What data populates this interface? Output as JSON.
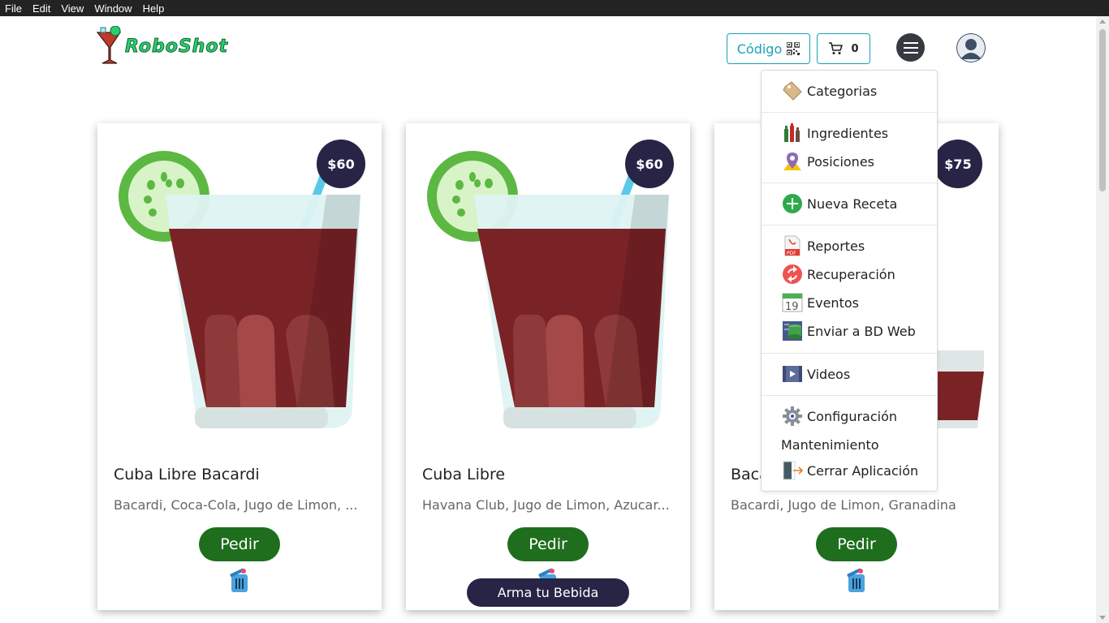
{
  "menubar": {
    "items": [
      "File",
      "Edit",
      "View",
      "Window",
      "Help"
    ]
  },
  "header": {
    "logo_text": "RoboShot",
    "codigo_label": "Código",
    "cart_count": "0"
  },
  "cards": [
    {
      "price": "$60",
      "title": "Cuba Libre Bacardi",
      "ingredients": "Bacardi, Coca-Cola, Jugo de Limon, ...",
      "pedir_label": "Pedir"
    },
    {
      "price": "$60",
      "title": "Cuba Libre",
      "ingredients": "Havana Club, Jugo de Limon, Azucar...",
      "pedir_label": "Pedir"
    },
    {
      "price": "$75",
      "title": "Baca",
      "ingredients": "Bacardi, Jugo de Limon, Granadina",
      "pedir_label": "Pedir"
    }
  ],
  "arma_label": "Arma tu Bebida",
  "dropdown": {
    "items": [
      {
        "label": "Categorias",
        "icon": "tag-icon"
      },
      {
        "label": "Ingredientes",
        "icon": "bottles-icon"
      },
      {
        "label": "Posiciones",
        "icon": "map-pin-icon"
      },
      {
        "label": "Nueva Receta",
        "icon": "plus-circle-icon"
      },
      {
        "label": "Reportes",
        "icon": "pdf-icon"
      },
      {
        "label": " Recuperación",
        "icon": "refresh-icon"
      },
      {
        "label": "Eventos",
        "icon": "calendar-icon"
      },
      {
        "label": "Enviar a BD Web",
        "icon": "database-icon"
      },
      {
        "label": "Videos",
        "icon": "video-icon"
      },
      {
        "label": "Configuración",
        "icon": "gear-icon"
      },
      {
        "label": "Mantenimiento",
        "icon": ""
      },
      {
        "label": "Cerrar Aplicación",
        "icon": "exit-icon"
      }
    ],
    "calendar_day": "19"
  },
  "colors": {
    "accent": "#17a2b8",
    "dark_badge": "#272446",
    "pedir_green": "#1e6e1e",
    "drink_red": "#7a2327",
    "lime": "#72c957"
  }
}
